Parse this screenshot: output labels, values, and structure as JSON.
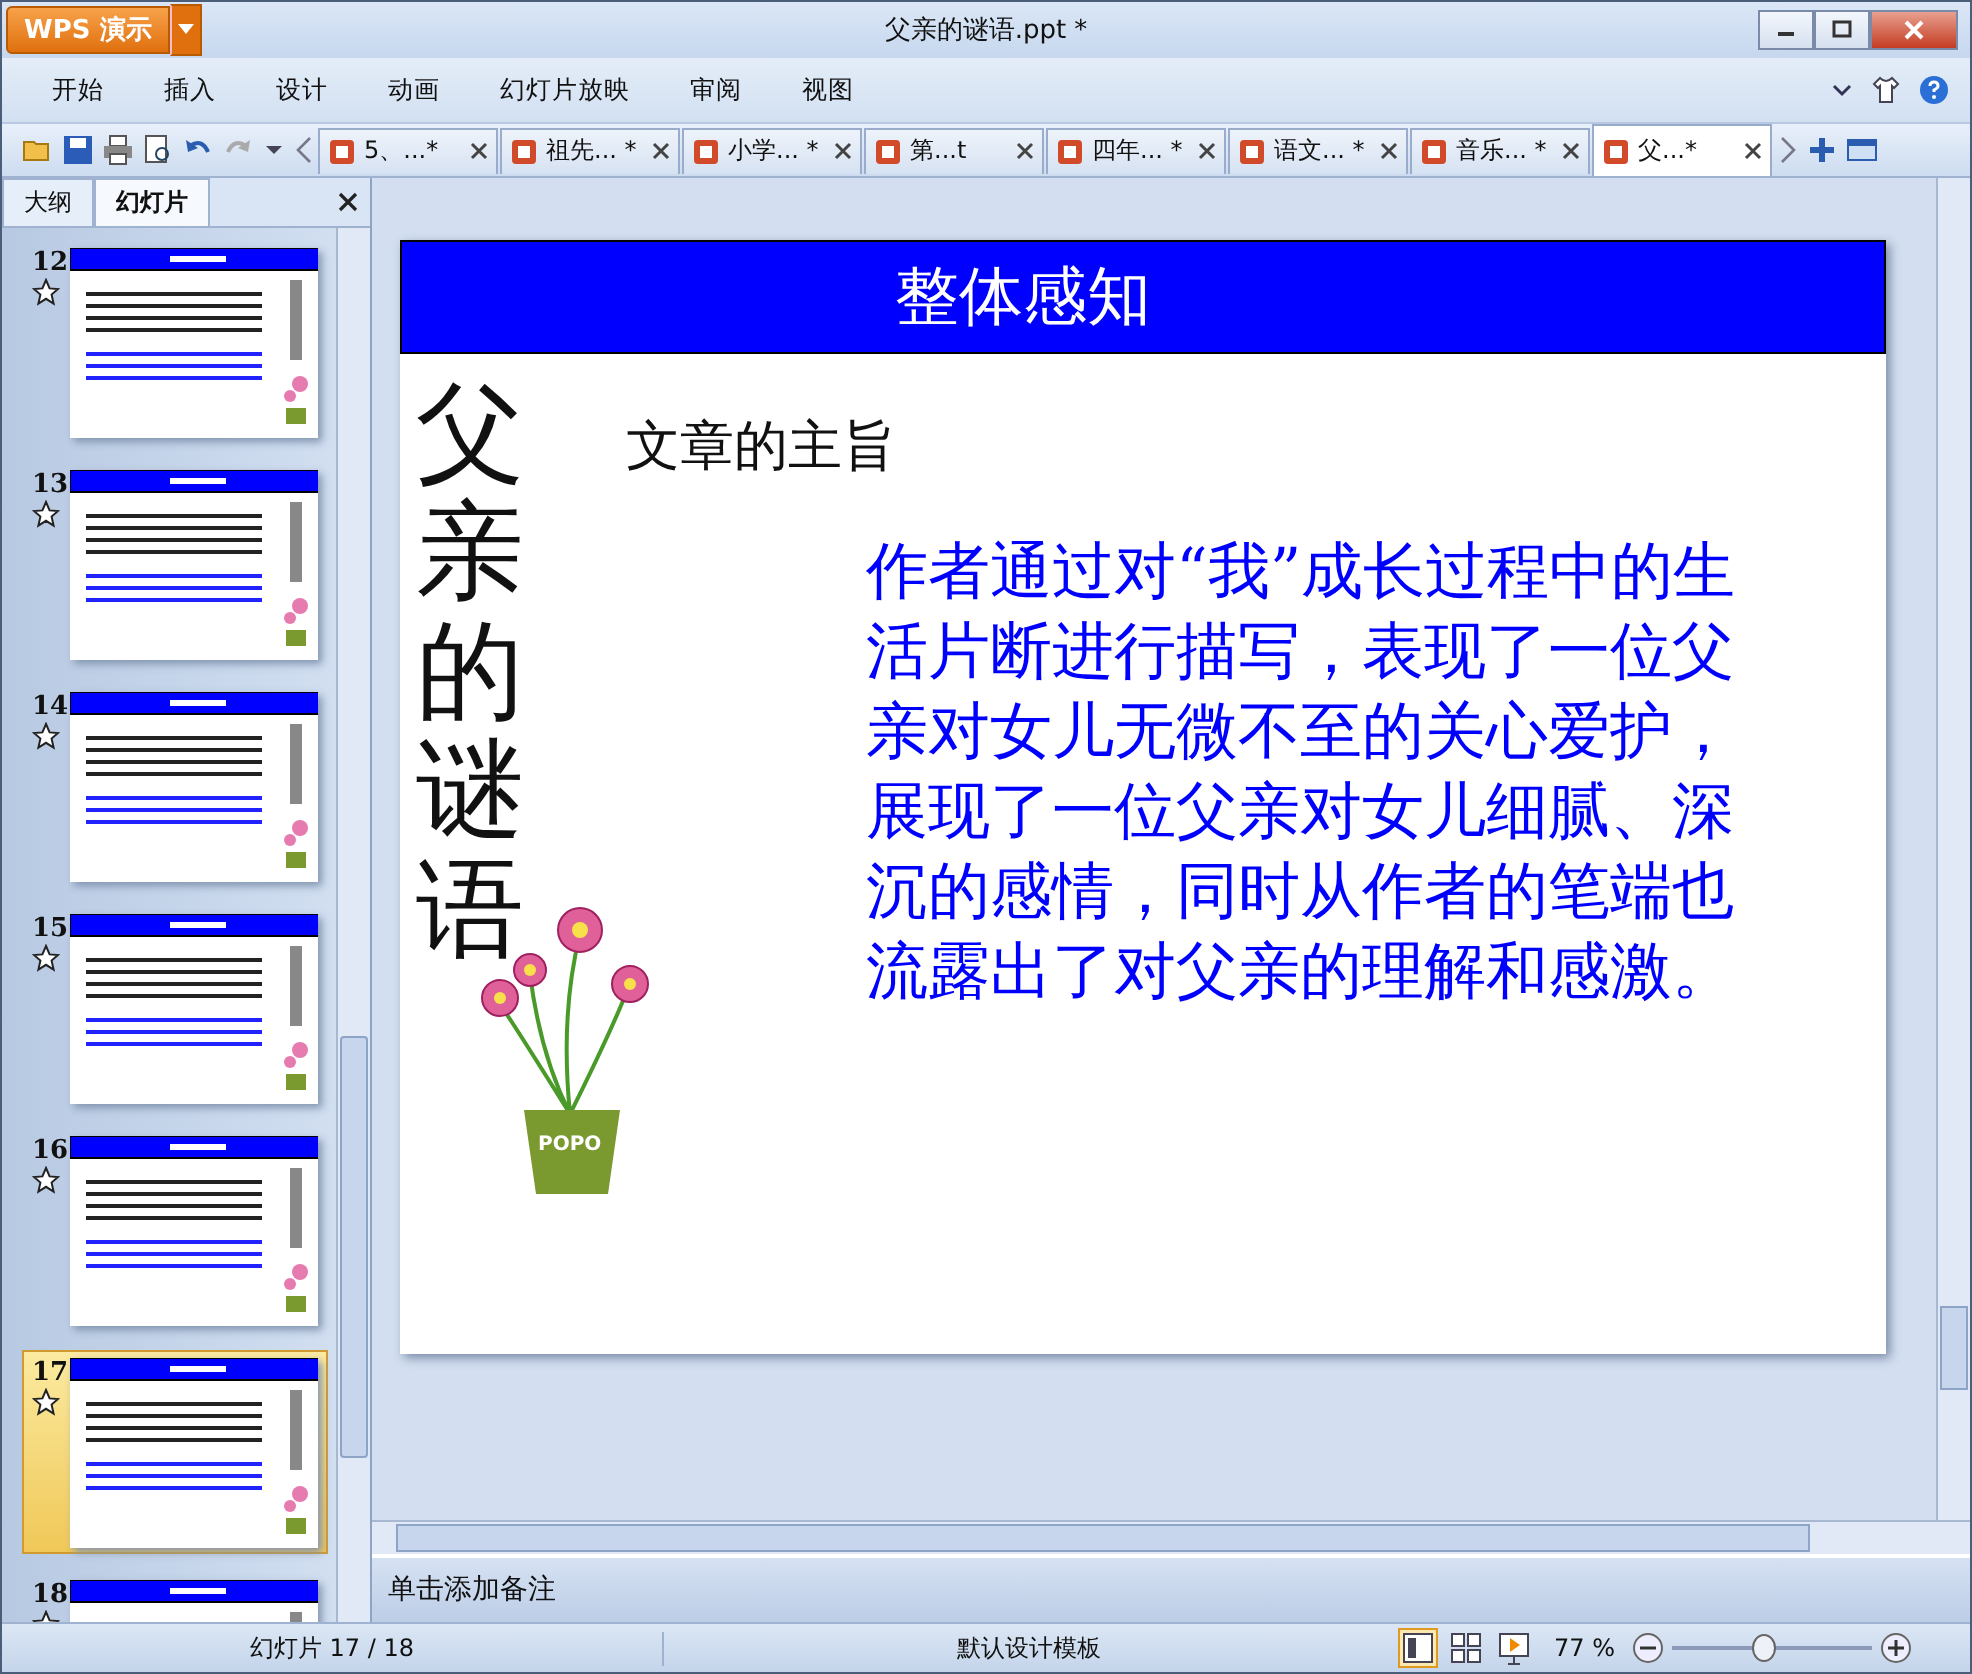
{
  "window": {
    "title": "父亲的谜语.ppt *",
    "app_button": "WPS 演示"
  },
  "menu": [
    "开始",
    "插入",
    "设计",
    "动画",
    "幻灯片放映",
    "审阅",
    "视图"
  ],
  "doc_tabs": [
    {
      "label": "5、...*",
      "selected": false
    },
    {
      "label": "祖先... *",
      "selected": false
    },
    {
      "label": "小学... *",
      "selected": false
    },
    {
      "label": "第...t",
      "selected": false
    },
    {
      "label": "四年... *",
      "selected": false
    },
    {
      "label": "语文... *",
      "selected": false
    },
    {
      "label": "音乐... *",
      "selected": false
    },
    {
      "label": "父...*",
      "selected": true
    }
  ],
  "panel_tabs": [
    {
      "label": "大纲",
      "selected": false
    },
    {
      "label": "幻灯片",
      "selected": true
    }
  ],
  "slides": [
    {
      "number": "12",
      "selected": false
    },
    {
      "number": "13",
      "selected": false
    },
    {
      "number": "14",
      "selected": false
    },
    {
      "number": "15",
      "selected": false
    },
    {
      "number": "16",
      "selected": false
    },
    {
      "number": "17",
      "selected": true
    },
    {
      "number": "18",
      "selected": false
    }
  ],
  "slide": {
    "header": "整体感知",
    "vertical_title": "父亲的谜语",
    "subtitle": "文章的主旨",
    "body": "作者通过对“我”成长过程中的生活片断进行描写，表现了一位父亲对女儿无微不至的关心爱护，展现了一位父亲对女儿细腻、深沉的感情，同时从作者的笔端也流露出了对父亲的理解和感激。",
    "pot_label": "POPO"
  },
  "notes": {
    "placeholder": "单击添加备注"
  },
  "status_bar": {
    "slide_counter": "幻灯片 17 / 18",
    "template": "默认设计模板",
    "zoom": "77 %",
    "zoom_slider": {
      "level": 0.45
    }
  }
}
